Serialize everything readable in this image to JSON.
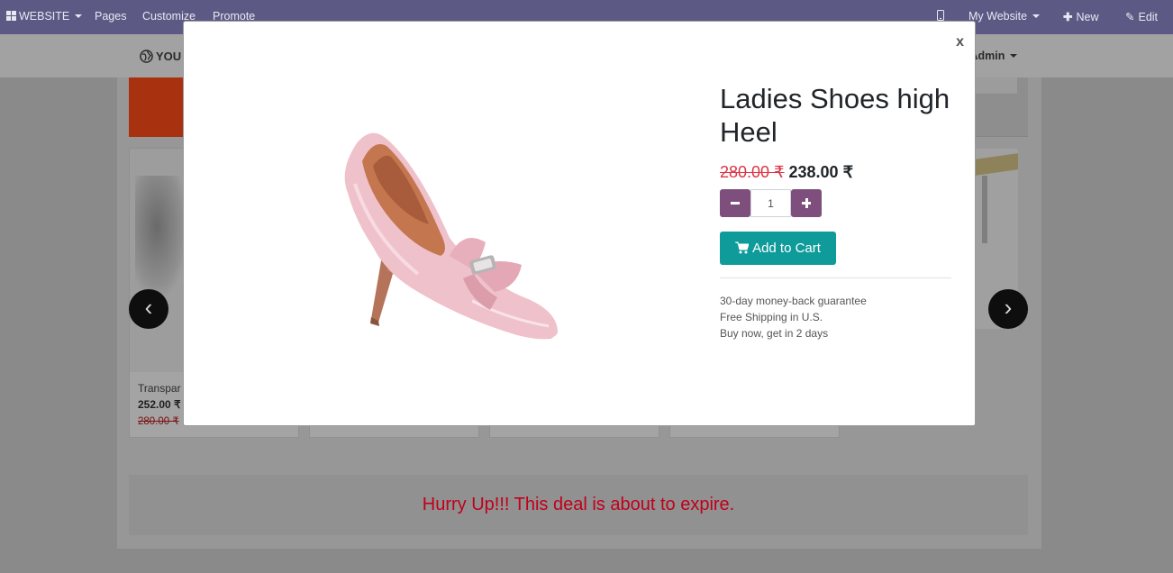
{
  "topbar": {
    "website_menu": "WEBSITE",
    "pages": "Pages",
    "customize": "Customize",
    "promote": "Promote",
    "my_website": "My Website",
    "new": "New",
    "edit": "Edit"
  },
  "header": {
    "logo_text": "YOU",
    "user_menu": "l Admin"
  },
  "carousel": {
    "prev": "‹",
    "next": "›",
    "cards": [
      {
        "name": "Transpar",
        "price": "252.00 ₹",
        "old_price": "280.00 ₹"
      }
    ]
  },
  "deal_banner": "Hurry Up!!! This deal is about to expire.",
  "modal": {
    "close": "x",
    "title": "Ladies Shoes high Heel",
    "old_price": "280.00 ₹",
    "price": "238.00 ₹",
    "quantity": "1",
    "add_to_cart": "Add to Cart",
    "benefits": [
      "30-day money-back guarantee",
      "Free Shipping in U.S.",
      "Buy now, get in 2 days"
    ]
  },
  "colors": {
    "topbar": "#5c5a84",
    "qty_button": "#7e4f7c",
    "add_to_cart": "#0f9b9a",
    "old_price": "#dc3545",
    "deal_text": "#c0001a"
  }
}
